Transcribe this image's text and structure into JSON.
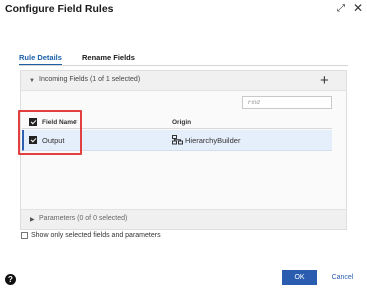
{
  "dialog": {
    "title": "Configure Field Rules"
  },
  "tabs": [
    {
      "label": "Rule Details",
      "active": true
    },
    {
      "label": "Rename Fields",
      "active": false
    }
  ],
  "incoming": {
    "title": "Incoming Fields (1 of 1 selected)",
    "find_placeholder": "Find",
    "columns": {
      "field_name": "Field Name",
      "origin": "Origin"
    },
    "rows": [
      {
        "field_name": "Output",
        "origin": "HierarchyBuilder",
        "checked": true
      }
    ]
  },
  "parameters": {
    "title": "Parameters (0 of 0 selected)"
  },
  "options": {
    "show_only_selected": "Show only selected fields and parameters"
  },
  "footer": {
    "ok": "OK",
    "cancel": "Cancel",
    "help": "?"
  },
  "colors": {
    "accent": "#2a5db0",
    "highlight": "#e24040",
    "row_selected": "#e5eefb"
  }
}
